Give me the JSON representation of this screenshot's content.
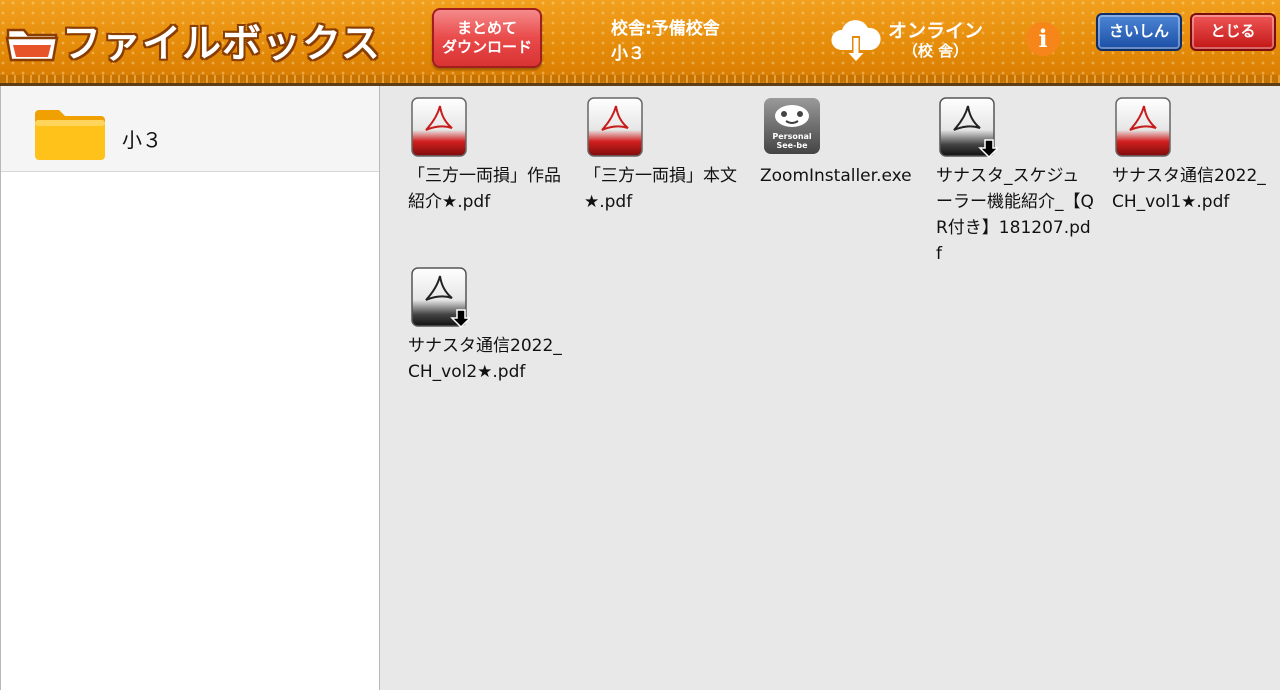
{
  "header": {
    "app_title": "ファイルボックス",
    "bulk_download_line1": "まとめて",
    "bulk_download_line2": "ダウンロード",
    "school_line1": "校舎:予備校舎",
    "school_line2": "小３",
    "status_line1": "オンライン",
    "status_line2": "（校 舎）",
    "info_label": "i",
    "refresh_label": "さいしん",
    "close_label": "とじる"
  },
  "sidebar": {
    "folders": [
      {
        "label": "小３"
      }
    ]
  },
  "files": [
    {
      "name": "「三方一両損」作品紹介★.pdf",
      "icon": "pdf-icon",
      "downloaded": true
    },
    {
      "name": "「三方一両損」本文★.pdf",
      "icon": "pdf-icon",
      "downloaded": true
    },
    {
      "name": "ZoomInstaller.exe",
      "icon": "personal-seebe-icon",
      "badge": "Personal See-be",
      "downloaded": true
    },
    {
      "name": "サナスタ_スケジューラー機能紹介_【QR付き】181207.pdf",
      "icon": "pdf-download-icon",
      "downloaded": false
    },
    {
      "name": "サナスタ通信2022_CH_vol1★.pdf",
      "icon": "pdf-icon",
      "downloaded": true
    },
    {
      "name": "サナスタ通信2022_CH_vol2★.pdf",
      "icon": "pdf-download-icon",
      "downloaded": false
    }
  ],
  "colors": {
    "header_orange": "#e48a08",
    "download_button_red": "#e94a4a",
    "refresh_button_blue": "#1b4fa6",
    "close_button_red": "#c21616",
    "folder_yellow": "#ffb300",
    "content_background": "#e8e8e8"
  }
}
